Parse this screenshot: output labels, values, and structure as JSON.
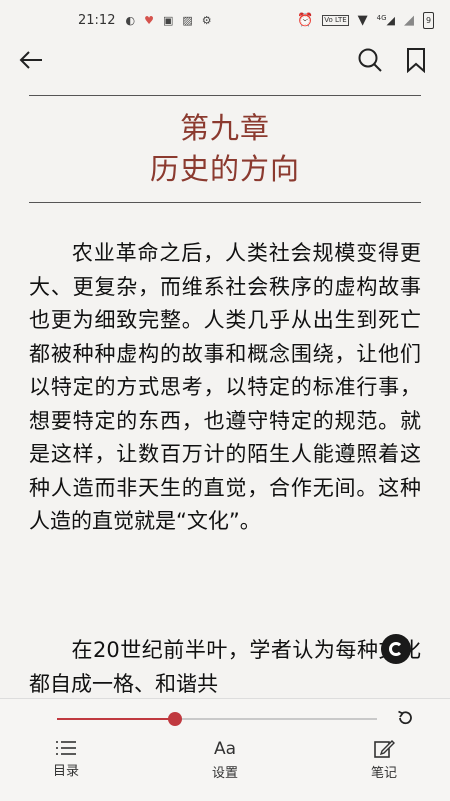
{
  "status_bar": {
    "time": "21:12",
    "left_icons": [
      "notification-icon",
      "heart-icon",
      "message-icon",
      "image-icon",
      "settings-icon"
    ],
    "right_icons": [
      "alarm-icon",
      "volte-icon",
      "wifi-icon",
      "signal-4g-icon",
      "no-signal-icon",
      "battery-icon"
    ],
    "network": "4G",
    "lte_label": "Vo LTE",
    "battery_label": "9"
  },
  "app_bar": {
    "back_icon": "arrow-left-icon",
    "search_icon": "search-icon",
    "bookmark_icon": "bookmark-icon"
  },
  "chapter": {
    "number": "第九章",
    "title": "历史的方向",
    "color": "#8b3a2f"
  },
  "content": {
    "paragraph1": "农业革命之后，人类社会规模变得更大、更复杂，而维系社会秩序的虚构故事也更为细致完整。人类几乎从出生到死亡都被种种虚构的故事和概念围绕，让他们以特定的方式思考，以特定的标准行事，想要特定的东西，也遵守特定的规范。就是这样，让数百万计的陌生人能遵照着这种人造而非天生的直觉，合作无间。这种人造的直觉就是“文化”。",
    "paragraph2": "在20世纪前半叶，学者认为每种文化都自成一格、和谐共"
  },
  "reader": {
    "progress": 0.37,
    "accent_color": "#c0393f"
  },
  "bottom_nav": {
    "toc_label": "目录",
    "settings_label": "设置",
    "settings_glyph": "Aa",
    "notes_label": "笔记"
  }
}
